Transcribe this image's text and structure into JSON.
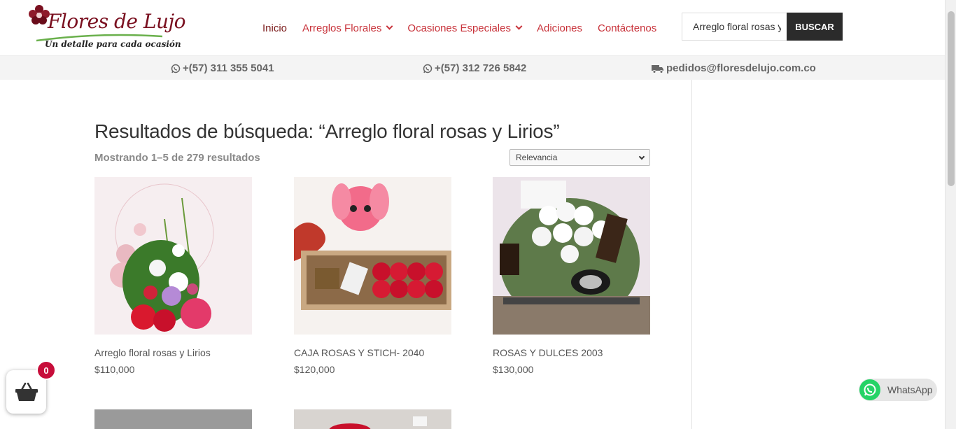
{
  "brand": {
    "name": "Flores de Lujo",
    "tagline": "Un detalle para cada ocasión"
  },
  "nav": {
    "items": [
      {
        "label": "Inicio",
        "active": true
      },
      {
        "label": "Arreglos Florales",
        "dropdown": true
      },
      {
        "label": "Ocasiones Especiales",
        "dropdown": true
      },
      {
        "label": "Adiciones"
      },
      {
        "label": "Contáctenos"
      }
    ]
  },
  "search": {
    "value": "Arreglo floral rosas y Lirios",
    "button_label": "BUSCAR"
  },
  "contact": {
    "phone1": "+(57) 311 355 5041",
    "phone2": "+(57) 312 726 5842",
    "email": "pedidos@floresdelujo.com.co"
  },
  "results": {
    "title": "Resultados de búsqueda: “Arreglo floral rosas y Lirios”",
    "count": "Mostrando 1–5 de 279 resultados",
    "sort_selected": "Relevancia"
  },
  "products": [
    {
      "name": "Arreglo floral rosas y Lirios",
      "price": "$110,000"
    },
    {
      "name": "CAJA ROSAS Y STICH- 2040",
      "price": "$120,000"
    },
    {
      "name": "ROSAS Y DULCES 2003",
      "price": "$130,000"
    }
  ],
  "cart": {
    "count": "0"
  },
  "whatsapp": {
    "label": "WhatsApp"
  },
  "colors": {
    "accent": "#c8323a",
    "nav_active": "#7a1a1a",
    "button_dark": "#2b2b2b",
    "badge": "#c70d3a",
    "whatsapp_green": "#25d366"
  }
}
